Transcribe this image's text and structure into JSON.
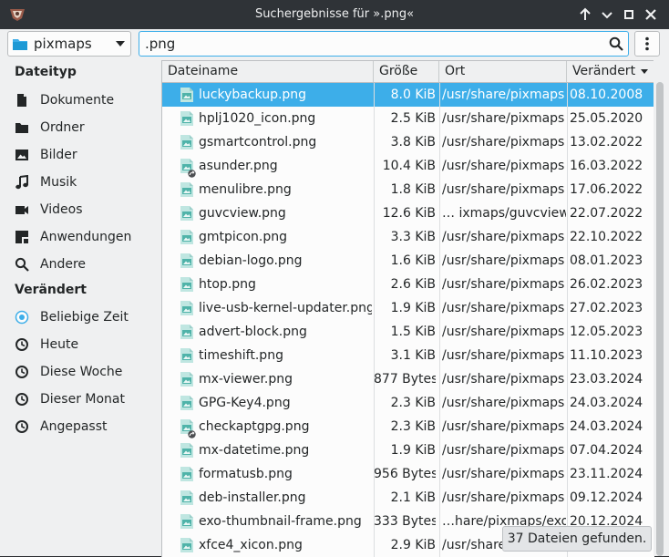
{
  "window": {
    "title": "Suchergebnisse für ».png«"
  },
  "toolbar": {
    "location": "pixmaps",
    "search_value": ".png"
  },
  "sidebar": {
    "section_type": "Dateityp",
    "types": [
      {
        "label": "Dokumente",
        "icon": "document-icon"
      },
      {
        "label": "Ordner",
        "icon": "folder-icon"
      },
      {
        "label": "Bilder",
        "icon": "image-icon"
      },
      {
        "label": "Musik",
        "icon": "music-icon"
      },
      {
        "label": "Videos",
        "icon": "video-icon"
      },
      {
        "label": "Anwendungen",
        "icon": "application-icon"
      },
      {
        "label": "Andere",
        "icon": "search-icon"
      }
    ],
    "section_changed": "Verändert",
    "changed": [
      {
        "label": "Beliebige Zeit",
        "icon": "radio-selected-icon",
        "selected": true
      },
      {
        "label": "Heute",
        "icon": "clock-icon"
      },
      {
        "label": "Diese Woche",
        "icon": "clock-icon"
      },
      {
        "label": "Dieser Monat",
        "icon": "clock-icon"
      },
      {
        "label": "Angepasst",
        "icon": "clock-icon"
      }
    ]
  },
  "table": {
    "columns": [
      "Dateiname",
      "Größe",
      "Ort",
      "Verändert"
    ],
    "sort_column": "Verändert",
    "rows": [
      {
        "name": "luckybackup.png",
        "size": "8.0 KiB",
        "location": "/usr/share/pixmaps",
        "date": "08.10.2008",
        "selected": true
      },
      {
        "name": "hplj1020_icon.png",
        "size": "2.5 KiB",
        "location": "/usr/share/pixmaps",
        "date": "25.05.2020"
      },
      {
        "name": "gsmartcontrol.png",
        "size": "3.8 KiB",
        "location": "/usr/share/pixmaps",
        "date": "13.02.2022"
      },
      {
        "name": "asunder.png",
        "size": "10.4 KiB",
        "location": "/usr/share/pixmaps",
        "date": "16.03.2022",
        "link": true
      },
      {
        "name": "menulibre.png",
        "size": "1.8 KiB",
        "location": "/usr/share/pixmaps",
        "date": "17.06.2022"
      },
      {
        "name": "guvcview.png",
        "size": "12.6 KiB",
        "location": "…  ixmaps/guvcview",
        "date": "22.07.2022"
      },
      {
        "name": "gmtpicon.png",
        "size": "3.3 KiB",
        "location": "/usr/share/pixmaps",
        "date": "22.10.2022"
      },
      {
        "name": "debian-logo.png",
        "size": "1.6 KiB",
        "location": "/usr/share/pixmaps",
        "date": "08.01.2023"
      },
      {
        "name": "htop.png",
        "size": "2.6 KiB",
        "location": "/usr/share/pixmaps",
        "date": "26.02.2023"
      },
      {
        "name": "live-usb-kernel-updater.png",
        "size": "1.9 KiB",
        "location": "/usr/share/pixmaps",
        "date": "27.02.2023"
      },
      {
        "name": "advert-block.png",
        "size": "1.5 KiB",
        "location": "/usr/share/pixmaps",
        "date": "12.05.2023"
      },
      {
        "name": "timeshift.png",
        "size": "3.1 KiB",
        "location": "/usr/share/pixmaps",
        "date": "11.10.2023"
      },
      {
        "name": "mx-viewer.png",
        "size": "877 Bytes",
        "location": "/usr/share/pixmaps",
        "date": "23.03.2024"
      },
      {
        "name": "GPG-Key4.png",
        "size": "2.3 KiB",
        "location": "/usr/share/pixmaps",
        "date": "24.03.2024"
      },
      {
        "name": "checkaptgpg.png",
        "size": "2.3 KiB",
        "location": "/usr/share/pixmaps",
        "date": "24.03.2024",
        "link": true
      },
      {
        "name": "mx-datetime.png",
        "size": "1.9 KiB",
        "location": "/usr/share/pixmaps",
        "date": "07.04.2024"
      },
      {
        "name": "formatusb.png",
        "size": "956 Bytes",
        "location": "/usr/share/pixmaps",
        "date": "23.11.2024"
      },
      {
        "name": "deb-installer.png",
        "size": "2.1 KiB",
        "location": "/usr/share/pixmaps",
        "date": "09.12.2024"
      },
      {
        "name": "exo-thumbnail-frame.png",
        "size": "333 Bytes",
        "location": "…hare/pixmaps/exo",
        "date": "20.12.2024"
      },
      {
        "name": "xfce4_xicon.png",
        "size": "2.9 KiB",
        "location": "/usr/share/pixmaps",
        "date": "23.12.2024"
      }
    ]
  },
  "status": "37 Dateien gefunden.",
  "colors": {
    "accent": "#3daee9",
    "titlebar": "#2f3337"
  }
}
